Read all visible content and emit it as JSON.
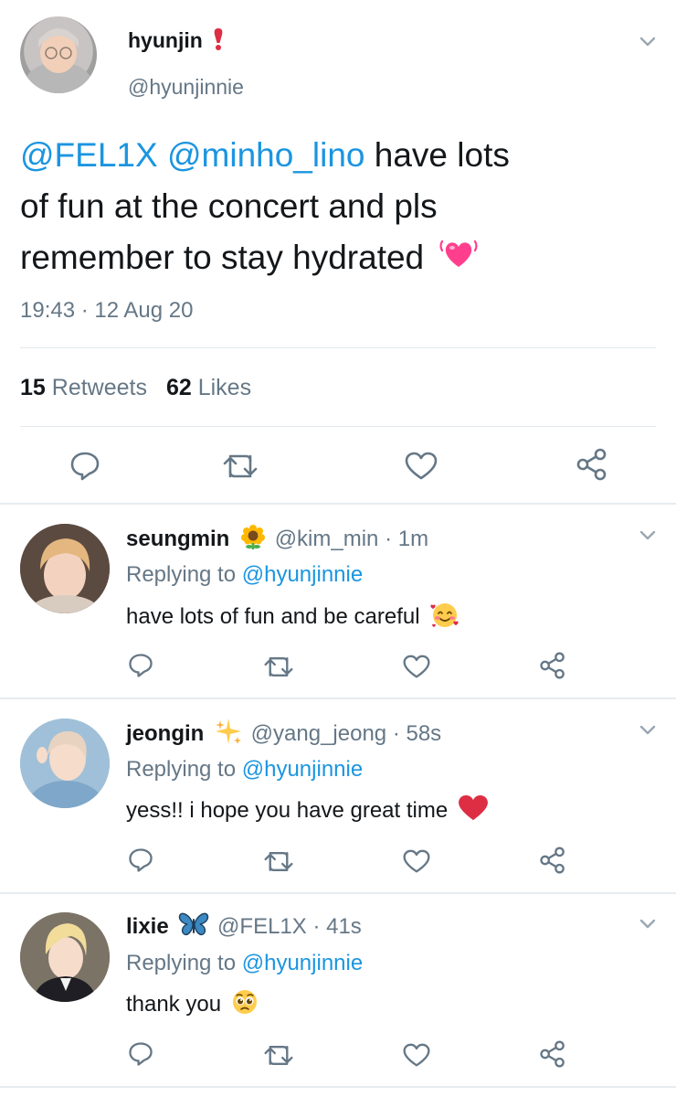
{
  "main_tweet": {
    "author_name": "hyunjin",
    "author_handle": "@hyunjinnie",
    "name_emoji": "red-exclamation-icon",
    "mention1": "@FEL1X",
    "mention2": "@minho_lino",
    "text_line1_rest": " have lots",
    "text_line2": "of fun at the concert and pls",
    "text_line3": "remember to stay hydrated",
    "text_emoji": "vibrating-heart-icon",
    "time": "19:43 · 12 Aug 20",
    "retweets_count": "15",
    "retweets_label": "Retweets",
    "likes_count": "62",
    "likes_label": "Likes"
  },
  "replies": [
    {
      "name": "seungmin",
      "name_emoji": "sunflower-icon",
      "handle": "@kim_min",
      "time": "· 1m",
      "replying_label": "Replying to",
      "replying_handle": "@hyunjinnie",
      "text": "have lots of fun and be careful",
      "text_emoji": "smiling-face-with-hearts-icon"
    },
    {
      "name": "jeongin",
      "name_emoji": "sparkles-icon",
      "handle": "@yang_jeong",
      "time": "· 58s",
      "replying_label": "Replying to",
      "replying_handle": "@hyunjinnie",
      "text": "yess!! i hope you have great time",
      "text_emoji": "red-heart-icon"
    },
    {
      "name": "lixie",
      "name_emoji": "butterfly-icon",
      "handle": "@FEL1X",
      "time": "· 41s",
      "replying_label": "Replying to",
      "replying_handle": "@hyunjinnie",
      "text": "thank you",
      "text_emoji": "pleading-face-icon"
    }
  ],
  "colors": {
    "link": "#1b95e0",
    "muted": "#657786",
    "text": "#14171a",
    "divider": "#e6ecf0"
  }
}
